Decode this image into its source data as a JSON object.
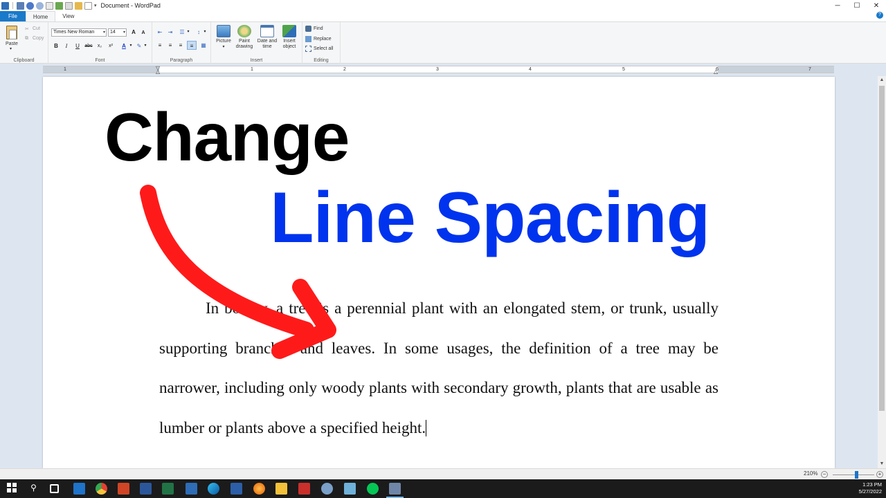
{
  "window": {
    "title": "Document - WordPad",
    "controls": {
      "minimize": "─",
      "maximize": "☐",
      "close": "✕",
      "help": "?"
    }
  },
  "tabs": {
    "file": "File",
    "home": "Home",
    "view": "View"
  },
  "ribbon": {
    "clipboard": {
      "label": "Clipboard",
      "paste": "Paste",
      "cut": "Cut",
      "copy": "Copy"
    },
    "font": {
      "label": "Font",
      "family": "Times New Roman",
      "size": "14",
      "bold": "B",
      "italic": "I",
      "underline": "U",
      "strike": "abc",
      "sub": "x₂",
      "sup": "x²",
      "grow": "A",
      "shrink": "A",
      "color": "A"
    },
    "paragraph": {
      "label": "Paragraph"
    },
    "insert": {
      "label": "Insert",
      "picture": "Picture",
      "paint_line1": "Paint",
      "paint_line2": "drawing",
      "date_line1": "Date and",
      "date_line2": "time",
      "object_line1": "Insert",
      "object_line2": "object"
    },
    "editing": {
      "label": "Editing",
      "find": "Find",
      "replace": "Replace",
      "select_all": "Select all"
    }
  },
  "ruler": {
    "numbers": [
      "1",
      "1",
      "2",
      "3",
      "4",
      "5",
      "6",
      "7"
    ]
  },
  "document": {
    "overlay_title_1": "Change",
    "overlay_title_2": "Line Spacing",
    "paragraph": "In botany, a tree is a perennial plant with an elongated stem, or trunk, usually supporting branches and leaves. In some usages, the definition of a tree may be narrower, including only woody plants with secondary growth, plants that are usable as lumber or plants above a specified height."
  },
  "status": {
    "zoom": "210%",
    "zoom_level_percent": 210,
    "zoom_minus": "−",
    "zoom_plus": "+"
  },
  "taskbar": {
    "time": "1:23 PM",
    "date": "5/27/2022"
  },
  "colors": {
    "accent": "#1979ca",
    "title_blue": "#0033ee",
    "arrow_red": "#ff1a1a",
    "taskbar": "#1b1b1b"
  }
}
